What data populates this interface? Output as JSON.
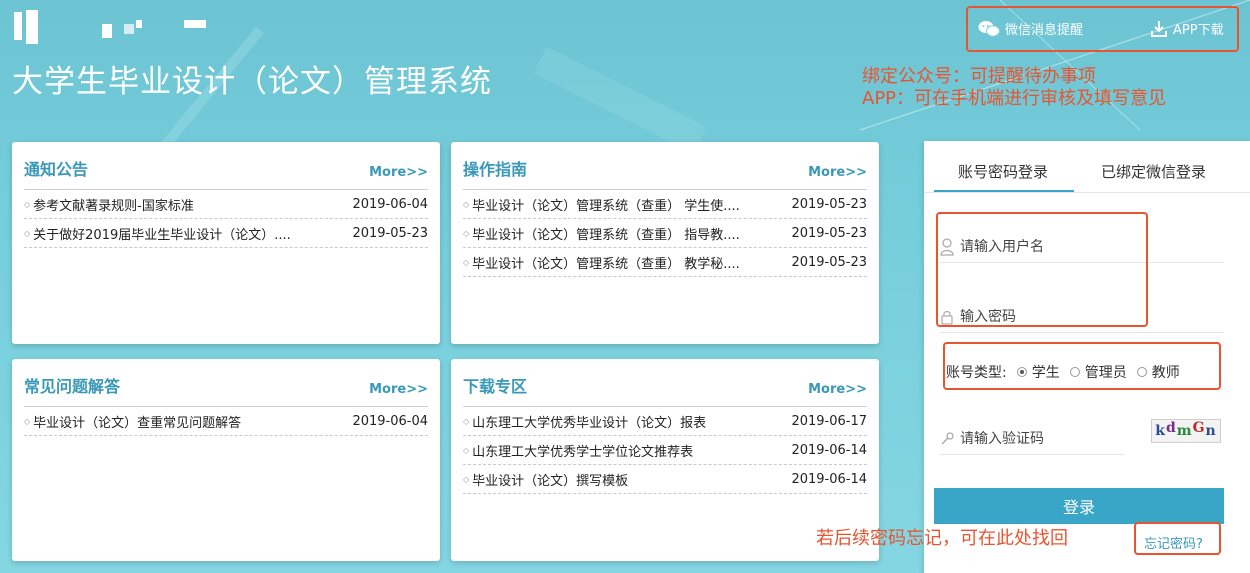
{
  "header": {
    "title": "大学生毕业设计（论文）管理系统",
    "wechat_label": "微信消息提醒",
    "app_label": "APP下载"
  },
  "annotations": {
    "tip_wechat": "绑定公众号：可提醒待办事项",
    "tip_app": "APP：可在手机端进行审核及填写意见",
    "tip_forgot": "若后续密码忘记，可在此处找回"
  },
  "panels": [
    {
      "title": "通知公告",
      "more": "More>>",
      "items": [
        {
          "text": "参考文献著录规则-国家标准",
          "date": "2019-06-04"
        },
        {
          "text": "关于做好2019届毕业生毕业设计（论文）....",
          "date": "2019-05-23"
        }
      ]
    },
    {
      "title": "操作指南",
      "more": "More>>",
      "items": [
        {
          "text": "毕业设计（论文）管理系统（查重） 学生使....",
          "date": "2019-05-23"
        },
        {
          "text": "毕业设计（论文）管理系统（查重） 指导教....",
          "date": "2019-05-23"
        },
        {
          "text": "毕业设计（论文）管理系统（查重） 教学秘....",
          "date": "2019-05-23"
        }
      ]
    },
    {
      "title": "常见问题解答",
      "more": "More>>",
      "items": [
        {
          "text": "毕业设计（论文）查重常见问题解答",
          "date": "2019-06-04"
        }
      ]
    },
    {
      "title": "下载专区",
      "more": "More>>",
      "items": [
        {
          "text": "山东理工大学优秀毕业设计（论文）报表",
          "date": "2019-06-17"
        },
        {
          "text": "山东理工大学优秀学士学位论文推荐表",
          "date": "2019-06-14"
        },
        {
          "text": "毕业设计（论文）撰写模板",
          "date": "2019-06-14"
        }
      ]
    }
  ],
  "login": {
    "tab_password": "账号密码登录",
    "tab_wechat": "已绑定微信登录",
    "username_placeholder": "请输入用户名",
    "password_placeholder": "输入密码",
    "account_type_label": "账号类型:",
    "account_types": [
      "学生",
      "管理员",
      "教师"
    ],
    "selected_type": "学生",
    "captcha_placeholder": "请输入验证码",
    "captcha_text": [
      "k",
      "d",
      "m",
      "G",
      "n"
    ],
    "login_button": "登录",
    "forgot_link": "忘记密码?"
  },
  "colors": {
    "accent": "#3aa6c7",
    "annotation_red": "#e8542f",
    "background": "#78cfdc"
  }
}
